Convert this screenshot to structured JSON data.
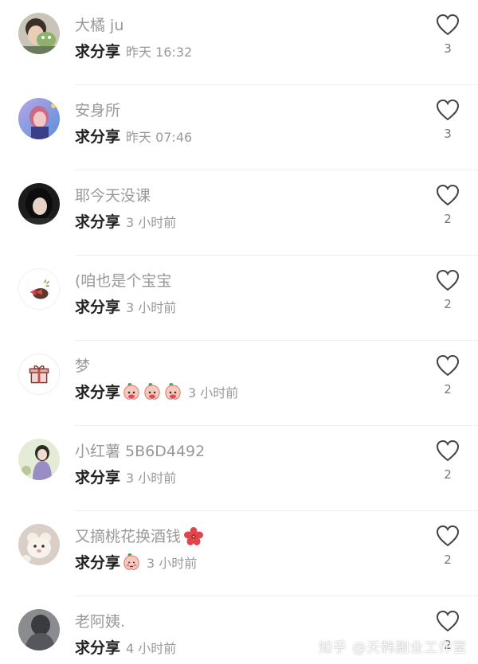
{
  "comments": [
    {
      "username": "大橘 ju",
      "text": "求分享",
      "emojis": [],
      "time": "昨天 16:32",
      "likes": "3",
      "avatar_icon": "avatar-photo-green"
    },
    {
      "username": "安身所",
      "text": "求分享",
      "emojis": [],
      "time": "昨天 07:46",
      "likes": "3",
      "avatar_icon": "avatar-photo-purple"
    },
    {
      "username": "耶今天没课",
      "text": "求分享",
      "emojis": [],
      "time": "3 小时前",
      "likes": "2",
      "avatar_icon": "avatar-photo-dark"
    },
    {
      "username": "(咱也是个宝宝",
      "text": "求分享",
      "emojis": [],
      "time": "3 小时前",
      "likes": "2",
      "avatar_icon": "avatar-cartoon-bow"
    },
    {
      "username": " 梦",
      "text": "求分享",
      "emojis": [
        "peach-emoji",
        "peach-emoji",
        "peach-emoji"
      ],
      "time": "3 小时前",
      "likes": "2",
      "avatar_icon": "avatar-gift"
    },
    {
      "username": "小红薯 5B6D4492",
      "text": "求分享",
      "emojis": [],
      "time": "3 小时前",
      "likes": "2",
      "avatar_icon": "avatar-photo-lavender"
    },
    {
      "username": "又摘桃花换酒钱",
      "text": "求分享",
      "emojis": [
        "peach-blush-emoji"
      ],
      "time": "3 小时前",
      "likes": "2",
      "avatar_icon": "avatar-photo-plush",
      "name_emoji": "hibiscus-emoji"
    },
    {
      "username": "老阿姨.",
      "text": "求分享",
      "emojis": [],
      "time": "4 小时前",
      "likes": "2",
      "avatar_icon": "avatar-photo-gray"
    }
  ],
  "watermark": "知乎 @天韩副业工作室",
  "colors": {
    "username": "#999999",
    "text": "#222222",
    "time": "#999999",
    "like_icon": "#444444",
    "divider": "#eeeeee"
  }
}
